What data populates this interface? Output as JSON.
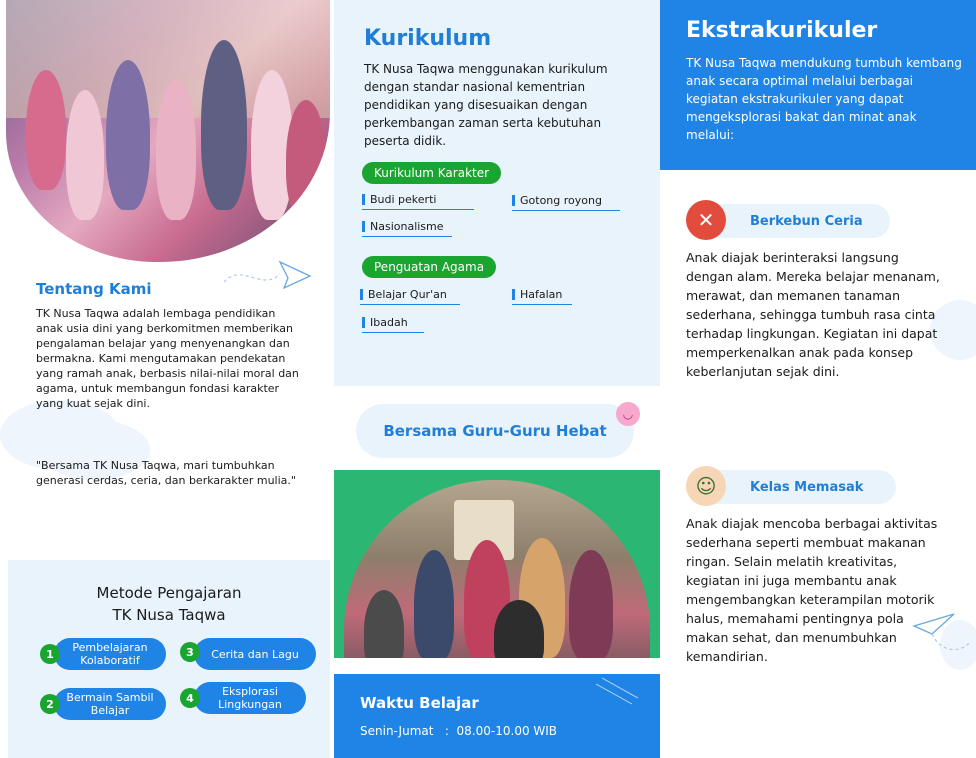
{
  "tentang": {
    "title": "Tentang Kami",
    "text": "TK Nusa Taqwa adalah lembaga pendidikan anak usia dini yang berkomitmen memberikan pengalaman belajar yang menyenangkan dan bermakna. Kami mengutamakan pendekatan yang ramah anak, berbasis nilai-nilai moral dan agama, untuk membangun fondasi karakter yang kuat sejak dini.",
    "quote": "\"Bersama TK Nusa Taqwa, mari tumbuhkan generasi cerdas, ceria, dan berkarakter mulia.\""
  },
  "metode": {
    "title_line1": "Metode Pengajaran",
    "title_line2": "TK Nusa Taqwa",
    "items": [
      {
        "num": "1",
        "label": "Pembelajaran Kolaboratif"
      },
      {
        "num": "2",
        "label": "Bermain Sambil Belajar"
      },
      {
        "num": "3",
        "label": "Cerita dan Lagu"
      },
      {
        "num": "4",
        "label": "Eksplorasi Lingkungan"
      }
    ]
  },
  "kurikulum": {
    "title": "Kurikulum",
    "text": "TK Nusa Taqwa menggunakan kurikulum dengan standar nasional kementrian pendidikan yang disesuaikan dengan perkembangan zaman serta kebutuhan peserta didik.",
    "karakter_label": "Kurikulum Karakter",
    "karakter_items": [
      "Budi pekerti",
      "Gotong royong",
      "Nasionalisme"
    ],
    "agama_label": "Penguatan Agama",
    "agama_items": [
      "Belajar Qur'an",
      "Hafalan",
      "Ibadah"
    ]
  },
  "guru": {
    "label": "Bersama Guru-Guru Hebat",
    "emoji": "◡"
  },
  "waktu": {
    "title": "Waktu Belajar",
    "line": "Senin-Jumat   :  08.00-10.00 WIB"
  },
  "ekstra": {
    "title": "Ekstrakurikuler",
    "text": "TK Nusa Taqwa mendukung tumbuh kembang anak secara optimal melalui berbagai kegiatan ekstrakurikuler yang dapat mengeksplorasi bakat dan minat anak melalui:",
    "activities": [
      {
        "name": "Berkebun Ceria",
        "icon": "garden-tools-icon",
        "text": "Anak diajak berinteraksi langsung dengan alam. Mereka belajar menanam, merawat, dan memanen tanaman sederhana, sehingga tumbuh rasa cinta terhadap lingkungan. Kegiatan ini dapat memperkenalkan anak pada konsep keberlanjutan sejak dini."
      },
      {
        "name": "Kelas Memasak",
        "icon": "chef-child-icon",
        "text": "Anak diajak mencoba berbagai aktivitas sederhana seperti membuat makanan ringan. Selain melatih kreativitas, kegiatan ini juga membantu anak mengembangkan keterampilan motorik halus, memahami pentingnya pola makan sehat, dan menumbuhkan kemandirian."
      }
    ]
  },
  "colors": {
    "brand_blue": "#1f84e6",
    "light_blue": "#e9f3fc",
    "green": "#1aa531",
    "teal_green": "#2bb673"
  }
}
